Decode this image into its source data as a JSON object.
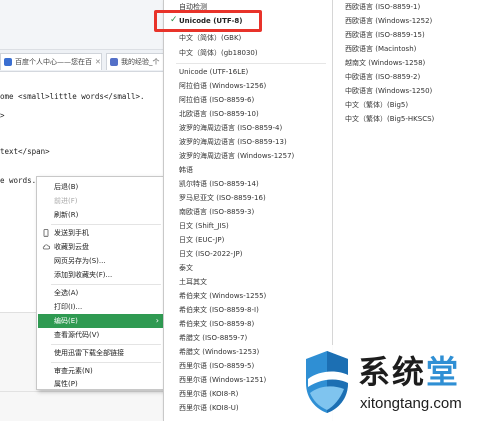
{
  "browser": {
    "tabs": [
      {
        "label": "百度个人中心——您在百",
        "color": "#3b6fd1"
      },
      {
        "label": "我的经验_个",
        "color": "#5470c8"
      }
    ],
    "code_lines": [
      "ome <small>little words</small>.",
      ">",
      "text</span>",
      "e words."
    ]
  },
  "context_menu": {
    "items": [
      {
        "label": "后退(B)",
        "disabled": false,
        "icon": ""
      },
      {
        "label": "前进(F)",
        "disabled": true,
        "icon": ""
      },
      {
        "label": "刷新(R)",
        "disabled": false,
        "icon": ""
      },
      {
        "label": "发送到手机",
        "disabled": false,
        "icon": "phone-icon"
      },
      {
        "label": "收藏到云盘",
        "disabled": false,
        "icon": "cloud-icon"
      },
      {
        "label": "网页另存为(S)...",
        "disabled": false,
        "icon": ""
      },
      {
        "label": "添加到收藏夹(F)...",
        "disabled": false,
        "icon": ""
      },
      {
        "label": "全选(A)",
        "disabled": false,
        "icon": ""
      },
      {
        "label": "打印(I)...",
        "disabled": false,
        "icon": ""
      },
      {
        "label": "编码(E)",
        "disabled": false,
        "icon": "",
        "active": true,
        "submenu": true
      },
      {
        "label": "查看源代码(V)",
        "disabled": false,
        "icon": ""
      },
      {
        "label": "使用迅雷下载全部链接",
        "disabled": false,
        "icon": ""
      },
      {
        "label": "审查元素(N)",
        "disabled": false,
        "icon": ""
      },
      {
        "label": "属性(P)",
        "disabled": false,
        "icon": ""
      }
    ],
    "active_color": "#2f9a52"
  },
  "encoding_menu": {
    "column1": [
      "自动检测",
      "Unicode (UTF-8)",
      "中文（简体）(GBK)",
      "中文（简体）(gb18030)",
      "Unicode (UTF-16LE)",
      "阿拉伯语 (Windows-1256)",
      "阿拉伯语 (ISO-8859-6)",
      "北欧语言 (ISO-8859-10)",
      "波罗的海周边语言 (ISO-8859-4)",
      "波罗的海周边语言 (ISO-8859-13)",
      "波罗的海周边语言 (Windows-1257)",
      "韩语",
      "凯尔特语 (ISO-8859-14)",
      "罗马尼亚文 (ISO-8859-16)",
      "南欧语言 (ISO-8859-3)",
      "日文 (Shift_JIS)",
      "日文 (EUC-JP)",
      "日文 (ISO-2022-JP)",
      "泰文",
      "土耳其文",
      "希伯来文 (Windows-1255)",
      "希伯来文 (ISO-8859-8-I)",
      "希伯来文 (ISO-8859-8)",
      "希腊文 (ISO-8859-7)",
      "希腊文 (Windows-1253)",
      "西里尔语 (ISO-8859-5)",
      "西里尔语 (Windows-1251)",
      "西里尔语 (KOI8-R)",
      "西里尔语 (KOI8-U)"
    ],
    "selected": "Unicode (UTF-8)",
    "column2": [
      "西欧语言 (ISO-8859-1)",
      "西欧语言 (Windows-1252)",
      "西欧语言 (ISO-8859-15)",
      "西欧语言 (Macintosh)",
      "越南文 (Windows-1258)",
      "中欧语言 (ISO-8859-2)",
      "中欧语言 (Windows-1250)",
      "中文（繁体）(Big5)",
      "中文（繁体）(Big5-HKSCS)"
    ],
    "highlight_color": "#e8332a",
    "check_color": "#2a8f4a"
  },
  "watermark": {
    "title_part1": "系统",
    "title_part2": "堂",
    "url": "xitongtang.com",
    "accent_color": "#2f8fd4"
  }
}
